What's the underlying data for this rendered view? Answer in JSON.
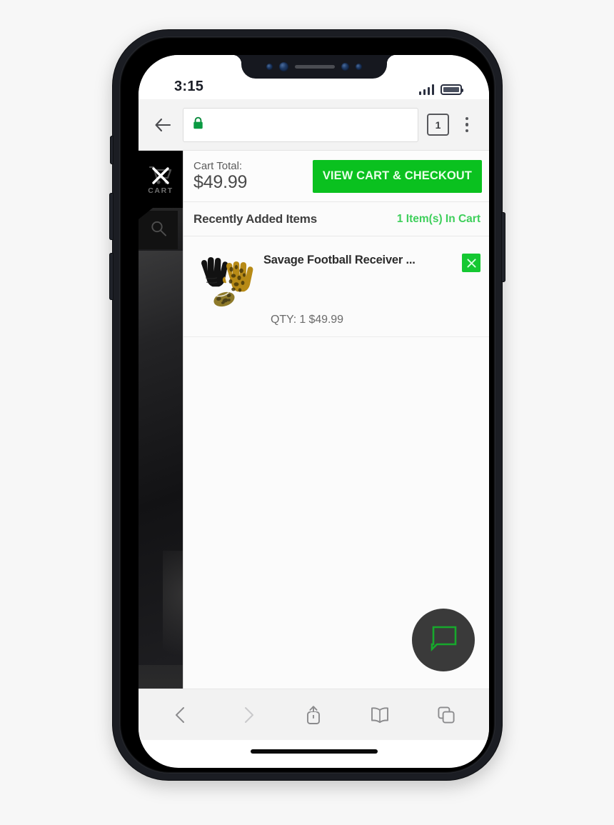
{
  "colors": {
    "brand_green": "#0ac11f",
    "accent_green_text": "#3ecf5b",
    "remove_green": "#15c832",
    "chat_bubble_green": "#17a82c",
    "fab_bg": "#3a3a3a",
    "dark_page_bg": "#141416",
    "cart_tab_bg": "#000000"
  },
  "status_bar": {
    "time": "3:15",
    "signal_icon": "signal-bars-icon",
    "battery_icon": "battery-icon",
    "sensors": [
      "sensor-dot-icon",
      "front-camera-icon",
      "speaker-grille-icon",
      "face-id-sensor-icon",
      "proximity-sensor-icon"
    ]
  },
  "browser": {
    "back_icon": "back-arrow-icon",
    "url_value": "",
    "url_placeholder": "",
    "lock_icon": "padlock-secure-icon",
    "tab_count": "1",
    "menu_icon": "more-vertical-icon",
    "toolbar": [
      {
        "name": "back",
        "icon": "chevron-left-icon",
        "enabled": true
      },
      {
        "name": "forward",
        "icon": "chevron-right-icon",
        "enabled": false
      },
      {
        "name": "share",
        "icon": "share-upload-icon",
        "enabled": true
      },
      {
        "name": "bookmarks",
        "icon": "book-open-icon",
        "enabled": true
      },
      {
        "name": "tabs",
        "icon": "copy-tabs-icon",
        "enabled": true
      }
    ]
  },
  "sidebar": {
    "cart_tab": {
      "label": "CART",
      "cart_icon": "shopping-cart-icon",
      "close_icon": "close-x-icon"
    },
    "search_tab": {
      "icon": "search-magnifier-icon"
    }
  },
  "cart": {
    "total_label": "Cart Total:",
    "total_value": "$49.99",
    "checkout_label": "VIEW CART & CHECKOUT",
    "recent_title": "Recently Added Items",
    "in_cart_count": "1 Item(s) In Cart",
    "items": [
      {
        "name": "Savage Football Receiver ...",
        "qty_line": "QTY: 1  $49.99",
        "thumb_icon": "football-gloves-product-image",
        "remove_icon": "close-x-icon"
      }
    ]
  },
  "chat": {
    "icon": "chat-bubble-icon"
  }
}
